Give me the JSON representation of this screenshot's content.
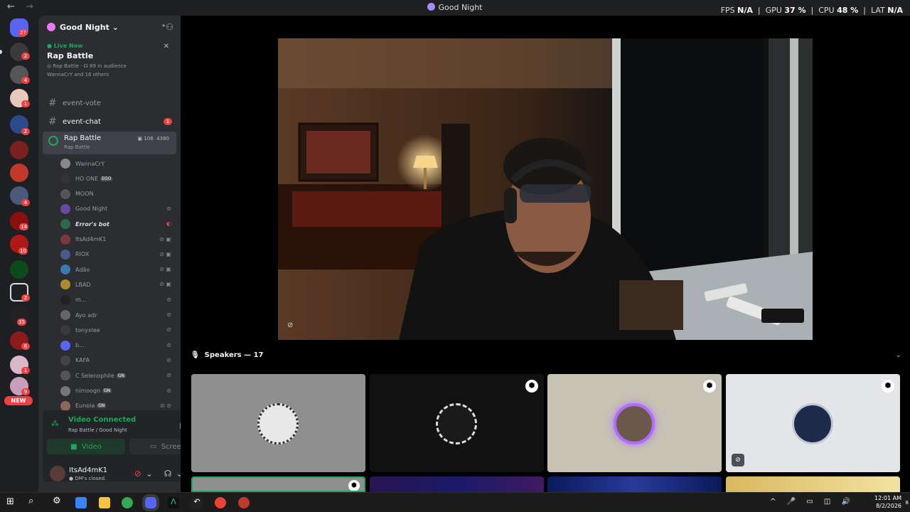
{
  "window": {
    "title": "Good Night"
  },
  "perf": {
    "fps_label": "FPS",
    "fps": "N/A",
    "gpu_label": "GPU",
    "gpu": "37 %",
    "cpu_label": "CPU",
    "cpu": "48 %",
    "lat_label": "LAT",
    "lat": "N/A"
  },
  "servers": {
    "badges": [
      "27",
      "2",
      "4",
      "1",
      "2",
      "4",
      "14",
      "10",
      "2",
      "35",
      "6",
      "1",
      "9"
    ],
    "new_label": "NEW"
  },
  "guild": {
    "name": "Good Night"
  },
  "live": {
    "status": "Live Now",
    "title": "Rap Battle",
    "stage": "Rap Battle",
    "audience": "89 in audience",
    "attendees": "WannaCrY and 16 others"
  },
  "channels": {
    "vote": "event-vote",
    "chat": "event-chat",
    "chat_badge": "1",
    "stage": "Rap Battle",
    "stage_sub": "Rap Battle",
    "stage_count": "106",
    "stage_bitrate": "4380"
  },
  "members": [
    {
      "name": "WannaCrY",
      "tag": ""
    },
    {
      "name": "HO ONE",
      "tag": "EGO"
    },
    {
      "name": "MOON",
      "tag": ""
    },
    {
      "name": "Good Night",
      "tag": ""
    },
    {
      "name": "Error's bot",
      "tag": ""
    },
    {
      "name": "ItsAd4mK1",
      "tag": ""
    },
    {
      "name": "RIOX",
      "tag": ""
    },
    {
      "name": "Adão",
      "tag": ""
    },
    {
      "name": "LBAD",
      "tag": ""
    },
    {
      "name": "m...",
      "tag": ""
    },
    {
      "name": "Ayo adr",
      "tag": ""
    },
    {
      "name": "tonyxlee",
      "tag": ""
    },
    {
      "name": "b...",
      "tag": ""
    },
    {
      "name": "KAFA",
      "tag": ""
    },
    {
      "name": "C Selenophile",
      "tag": "GN"
    },
    {
      "name": "nimoogn",
      "tag": "GN"
    },
    {
      "name": "Eunoia",
      "tag": "GN"
    }
  ],
  "connection": {
    "status": "Video Connected",
    "location": "Rap Battle / Good Night",
    "video_label": "Video",
    "screen_label": "Screen"
  },
  "user": {
    "name": "ItsAd4mK1",
    "status": "DM's closed."
  },
  "speakers": {
    "header": "Speakers — 17"
  },
  "clock": {
    "time": "12:01 AM",
    "date": "8/2/2026",
    "notifications": "8"
  }
}
